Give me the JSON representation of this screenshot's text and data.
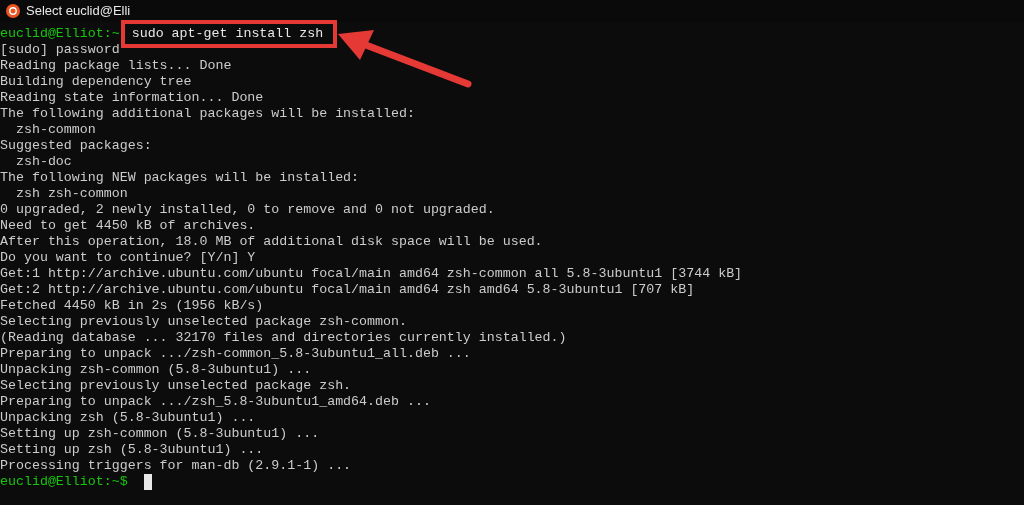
{
  "window": {
    "title": "Select euclid@Elli"
  },
  "lines": [
    {
      "kind": "prompt",
      "user": "euclid@Elliot:~",
      "command": "sudo apt-get install zsh",
      "cursor": false
    },
    {
      "kind": "output",
      "text": "[sudo] password"
    },
    {
      "kind": "output",
      "text": "Reading package lists... Done"
    },
    {
      "kind": "output",
      "text": "Building dependency tree"
    },
    {
      "kind": "output",
      "text": "Reading state information... Done"
    },
    {
      "kind": "output",
      "text": "The following additional packages will be installed:"
    },
    {
      "kind": "output",
      "text": "  zsh-common"
    },
    {
      "kind": "output",
      "text": "Suggested packages:"
    },
    {
      "kind": "output",
      "text": "  zsh-doc"
    },
    {
      "kind": "output",
      "text": "The following NEW packages will be installed:"
    },
    {
      "kind": "output",
      "text": "  zsh zsh-common"
    },
    {
      "kind": "output",
      "text": "0 upgraded, 2 newly installed, 0 to remove and 0 not upgraded."
    },
    {
      "kind": "output",
      "text": "Need to get 4450 kB of archives."
    },
    {
      "kind": "output",
      "text": "After this operation, 18.0 MB of additional disk space will be used."
    },
    {
      "kind": "output",
      "text": "Do you want to continue? [Y/n] Y"
    },
    {
      "kind": "output",
      "text": "Get:1 http://archive.ubuntu.com/ubuntu focal/main amd64 zsh-common all 5.8-3ubuntu1 [3744 kB]"
    },
    {
      "kind": "output",
      "text": "Get:2 http://archive.ubuntu.com/ubuntu focal/main amd64 zsh amd64 5.8-3ubuntu1 [707 kB]"
    },
    {
      "kind": "output",
      "text": "Fetched 4450 kB in 2s (1956 kB/s)"
    },
    {
      "kind": "output",
      "text": "Selecting previously unselected package zsh-common."
    },
    {
      "kind": "output",
      "text": "(Reading database ... 32170 files and directories currently installed.)"
    },
    {
      "kind": "output",
      "text": "Preparing to unpack .../zsh-common_5.8-3ubuntu1_all.deb ..."
    },
    {
      "kind": "output",
      "text": "Unpacking zsh-common (5.8-3ubuntu1) ..."
    },
    {
      "kind": "output",
      "text": "Selecting previously unselected package zsh."
    },
    {
      "kind": "output",
      "text": "Preparing to unpack .../zsh_5.8-3ubuntu1_amd64.deb ..."
    },
    {
      "kind": "output",
      "text": "Unpacking zsh (5.8-3ubuntu1) ..."
    },
    {
      "kind": "output",
      "text": "Setting up zsh-common (5.8-3ubuntu1) ..."
    },
    {
      "kind": "output",
      "text": "Setting up zsh (5.8-3ubuntu1) ..."
    },
    {
      "kind": "output",
      "text": "Processing triggers for man-db (2.9.1-1) ..."
    },
    {
      "kind": "prompt",
      "user": "euclid@Elliot:~$",
      "cursor": true
    }
  ]
}
